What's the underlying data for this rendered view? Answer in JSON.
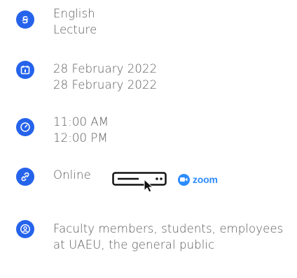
{
  "language": {
    "icon": "language-icon",
    "lines": [
      "English",
      "Lecture"
    ]
  },
  "date": {
    "icon": "calendar-icon",
    "start": "28 February 2022",
    "end": "28 February 2022"
  },
  "time": {
    "icon": "clock-icon",
    "start": "11:00 AM",
    "end": "12:00 PM"
  },
  "location": {
    "icon": "link-icon",
    "label": "Online",
    "click_icon": "click-here-icon",
    "platform": "zoom"
  },
  "audience": {
    "icon": "users-icon",
    "text": "Faculty members, students, employees at UAEU, the general public"
  },
  "colors": {
    "accent": "#2563eb",
    "zoom": "#2d8cff",
    "text": "#595959"
  }
}
